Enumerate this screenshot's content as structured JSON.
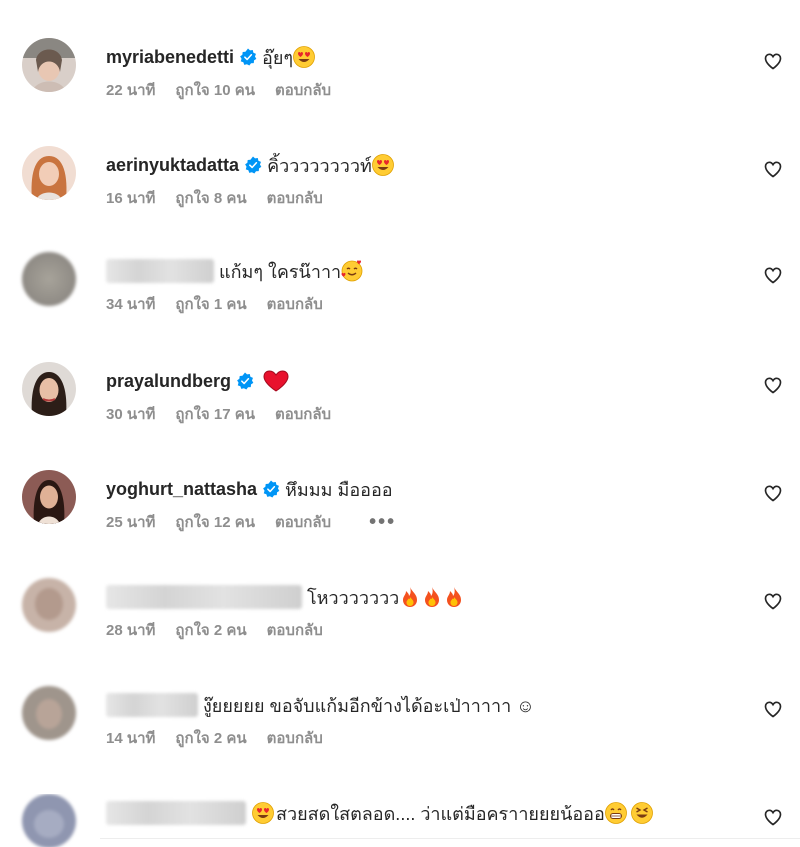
{
  "comments": [
    {
      "username": "myriabenedetti",
      "verified": true,
      "masked": false,
      "text": "อุ๊ยๆ",
      "emojis": [
        "heart-eyes"
      ],
      "time": "22 นาที",
      "likes": "ถูกใจ 10 คน",
      "reply": "ตอบกลับ"
    },
    {
      "username": "aerinyuktadatta",
      "verified": true,
      "masked": false,
      "text": "คิ้ววววววววท์",
      "emojis": [
        "heart-eyes"
      ],
      "time": "16 นาที",
      "likes": "ถูกใจ 8 คน",
      "reply": "ตอบกลับ"
    },
    {
      "username": "",
      "verified": false,
      "masked": true,
      "text": "แก้มๆ ใครน๊าาา",
      "emojis": [
        "smiling-hearts"
      ],
      "time": "34 นาที",
      "likes": "ถูกใจ 1 คน",
      "reply": "ตอบกลับ"
    },
    {
      "username": "prayalundberg",
      "verified": true,
      "masked": false,
      "text": "",
      "emojis": [
        "red-heart"
      ],
      "time": "30 นาที",
      "likes": "ถูกใจ 17 คน",
      "reply": "ตอบกลับ"
    },
    {
      "username": "yoghurt_nattasha",
      "verified": true,
      "masked": false,
      "text": "หึมมม มืออออ",
      "emojis": [],
      "time": "25 นาที",
      "likes": "ถูกใจ 12 คน",
      "reply": "ตอบกลับ",
      "more": "•••"
    },
    {
      "username": "",
      "verified": false,
      "masked": true,
      "text": "โหววววววว",
      "emojis": [
        "fire",
        "fire",
        "fire"
      ],
      "time": "28 นาที",
      "likes": "ถูกใจ 2 คน",
      "reply": "ตอบกลับ"
    },
    {
      "username": "",
      "verified": false,
      "masked": true,
      "text": "งู๊ยยยยย ขอจับแก้มอีกข้างได้อะเป่าาาาา ☺",
      "emojis": [],
      "time": "14 นาที",
      "likes": "ถูกใจ 2 คน",
      "reply": "ตอบกลับ"
    },
    {
      "username": "",
      "verified": false,
      "masked": true,
      "text": "สวยสดใสตลอด.... ว่าแต่มือคราายยยน้อออ",
      "emojis_before": [
        "heart-eyes"
      ],
      "emojis": [
        "grin",
        "squint-laugh"
      ],
      "time": "",
      "likes": "",
      "reply": ""
    }
  ],
  "colors": {
    "verified": "#0095f6",
    "meta_text": "#8e8e8e",
    "primary_text": "#262626"
  }
}
